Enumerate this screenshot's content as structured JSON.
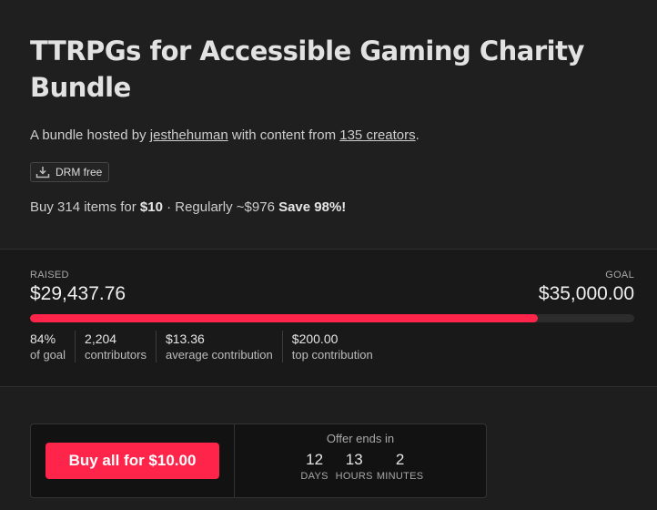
{
  "bundle": {
    "title": "TTRPGs for Accessible Gaming Charity Bundle",
    "byline_prefix": "A bundle hosted by ",
    "host": "jesthehuman",
    "byline_middle": " with content from ",
    "creators_link": "135 creators",
    "byline_suffix": ".",
    "drm_label": "DRM free",
    "price_prefix": "Buy 314 items for ",
    "price": "$10",
    "price_middle": " · Regularly ~$976 ",
    "savings": "Save 98%!"
  },
  "fundraiser": {
    "raised_label": "RAISED",
    "goal_label": "GOAL",
    "raised_amount": "$29,437.76",
    "goal_amount": "$35,000.00",
    "progress_fraction": 0.841,
    "stats": [
      {
        "value": "84%",
        "label": "of goal"
      },
      {
        "value": "2,204",
        "label": "contributors"
      },
      {
        "value": "$13.36",
        "label": "average contribution"
      },
      {
        "value": "$200.00",
        "label": "top contribution"
      }
    ],
    "accent_color": "#ff2449"
  },
  "purchase": {
    "button_label": "Buy all for $10.00",
    "offer_label": "Offer ends in",
    "countdown": [
      {
        "value": "12",
        "unit": "DAYS"
      },
      {
        "value": "13",
        "unit": "HOURS"
      },
      {
        "value": "2",
        "unit": "MINUTES"
      }
    ]
  }
}
